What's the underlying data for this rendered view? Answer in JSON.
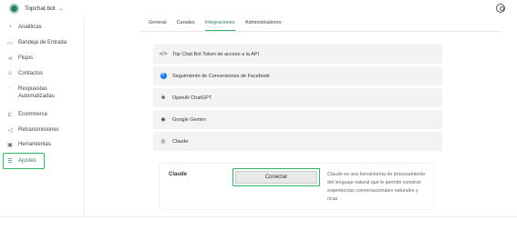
{
  "app": {
    "name": "Topchat.bot"
  },
  "sidebar": {
    "items": [
      {
        "label": "Analiticas",
        "icon": "chart-pie-icon"
      },
      {
        "label": "Bandeja de Entrada",
        "icon": "inbox-icon"
      },
      {
        "label": "Flujos",
        "icon": "flow-icon"
      },
      {
        "label": "Contactos",
        "icon": "contacts-icon"
      },
      {
        "label": "Respuestas",
        "label2": "Automatizadas",
        "icon": "chat-icon"
      },
      {
        "label": "Ecommerce",
        "icon": "cart-icon"
      },
      {
        "label": "Retransmisiones",
        "icon": "broadcast-icon"
      },
      {
        "label": "Herramientas",
        "icon": "toolbox-icon"
      },
      {
        "label": "Ajustes",
        "icon": "settings-icon"
      }
    ]
  },
  "tabs": [
    {
      "label": "General"
    },
    {
      "label": "Canales"
    },
    {
      "label": "Integraciones"
    },
    {
      "label": "Administradores"
    }
  ],
  "integrations": [
    {
      "label": "Top Chat Bot Token de acceso a la API",
      "icon": "code-icon"
    },
    {
      "label": "Seguimiento de Conversiones de Facebook",
      "icon": "facebook-icon"
    },
    {
      "label": "OpenAI ChatGPT",
      "icon": "openai-icon"
    },
    {
      "label": "Google Gemini",
      "icon": "gemini-icon"
    },
    {
      "label": "Claude",
      "icon": "claude-icon"
    }
  ],
  "claude_panel": {
    "title": "Claude",
    "button_label": "Conectar",
    "description": "Claude es una herramienta de procesamiento del lenguaje natural que le permite construir experiencias conversacionales naturales y ricas"
  },
  "colors": {
    "accent": "#2fb36b",
    "brand": "#2e7d5b"
  }
}
